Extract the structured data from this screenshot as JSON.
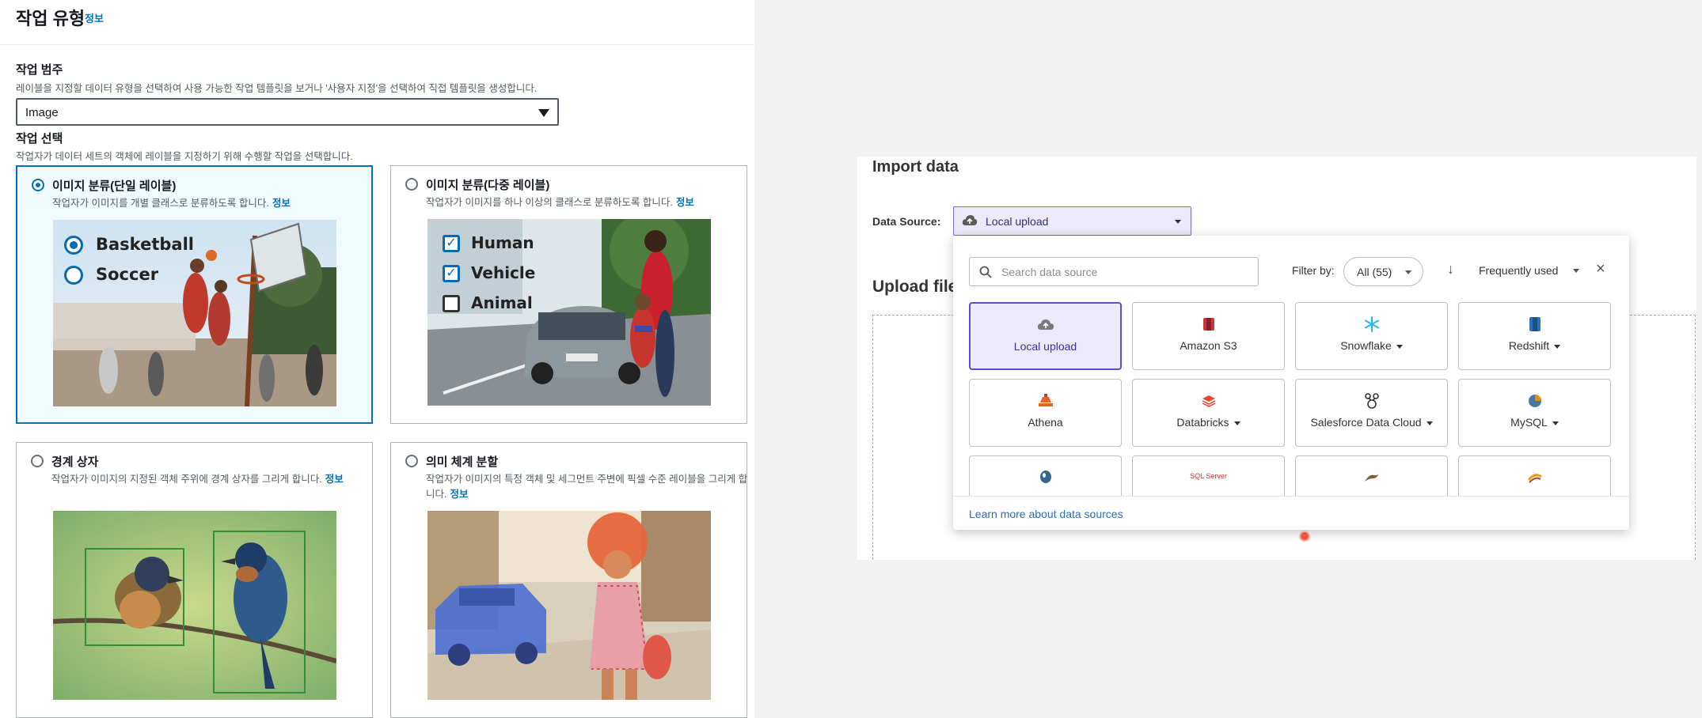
{
  "left": {
    "title": "작업 유형",
    "title_info": "정보",
    "category_label": "작업 범주",
    "category_desc": "레이블을 지정할 데이터 유형을 선택하여 사용 가능한 작업 템플릿을 보거나 '사용자 지정'을 선택하여 직접 템플릿을 생성합니다.",
    "category_value": "Image",
    "task_label": "작업 선택",
    "task_desc": "작업자가 데이터 세트의 객체에 레이블을 지정하기 위해 수행할 작업을 선택합니다.",
    "cards": [
      {
        "title": "이미지 분류(단일 레이블)",
        "desc": "작업자가 이미지를 개별 클래스로 분류하도록 합니다.",
        "info": "정보",
        "selected": true,
        "labels": [
          "Basketball",
          "Soccer"
        ]
      },
      {
        "title": "이미지 분류(다중 레이블)",
        "desc": "작업자가 이미지를 하나 이상의 클래스로 분류하도록 합니다.",
        "info": "정보",
        "selected": false,
        "labels": [
          "Human",
          "Vehicle",
          "Animal"
        ]
      },
      {
        "title": "경계 상자",
        "desc": "작업자가 이미지의 지정된 객체 주위에 경계 상자를 그리게 합니다.",
        "info": "정보",
        "selected": false
      },
      {
        "title": "의미 체계 분할",
        "desc": "작업자가 이미지의 특정 객체 및 세그먼트 주변에 픽셀 수준 레이블을 그리게 합니다.",
        "info": "정보",
        "selected": false
      }
    ]
  },
  "right": {
    "import_title": "Import data",
    "data_source_label": "Data Source:",
    "data_source_value": "Local upload",
    "upload_title": "Upload file",
    "popup": {
      "search_placeholder": "Search data source",
      "filter_label": "Filter by:",
      "filter_value": "All (55)",
      "sort_value": "Frequently used",
      "tiles": [
        {
          "label": "Local upload",
          "icon": "cloud-upload-icon",
          "dropdown": false,
          "selected": true
        },
        {
          "label": "Amazon S3",
          "icon": "amazon-s3-icon",
          "dropdown": false,
          "selected": false
        },
        {
          "label": "Snowflake",
          "icon": "snowflake-icon",
          "dropdown": true,
          "selected": false
        },
        {
          "label": "Redshift",
          "icon": "redshift-icon",
          "dropdown": true,
          "selected": false
        },
        {
          "label": "Athena",
          "icon": "athena-icon",
          "dropdown": false,
          "selected": false
        },
        {
          "label": "Databricks",
          "icon": "databricks-icon",
          "dropdown": true,
          "selected": false
        },
        {
          "label": "Salesforce Data Cloud",
          "icon": "salesforce-icon",
          "dropdown": true,
          "selected": false
        },
        {
          "label": "MySQL",
          "icon": "mysql-icon",
          "dropdown": true,
          "selected": false
        }
      ],
      "partial_tiles": [
        {
          "icon": "postgresql-icon",
          "text": ""
        },
        {
          "icon": "sql-server-icon",
          "text": "SQL Server"
        },
        {
          "icon": "mariadb-icon",
          "text": ""
        },
        {
          "icon": "apache-icon",
          "text": ""
        }
      ],
      "footer_link": "Learn more about data sources"
    }
  },
  "colors": {
    "aws_blue": "#0073bb",
    "selected_purple": "#5b4fc9",
    "selected_bg": "#ece9fb",
    "cursor": "#e8543d"
  }
}
